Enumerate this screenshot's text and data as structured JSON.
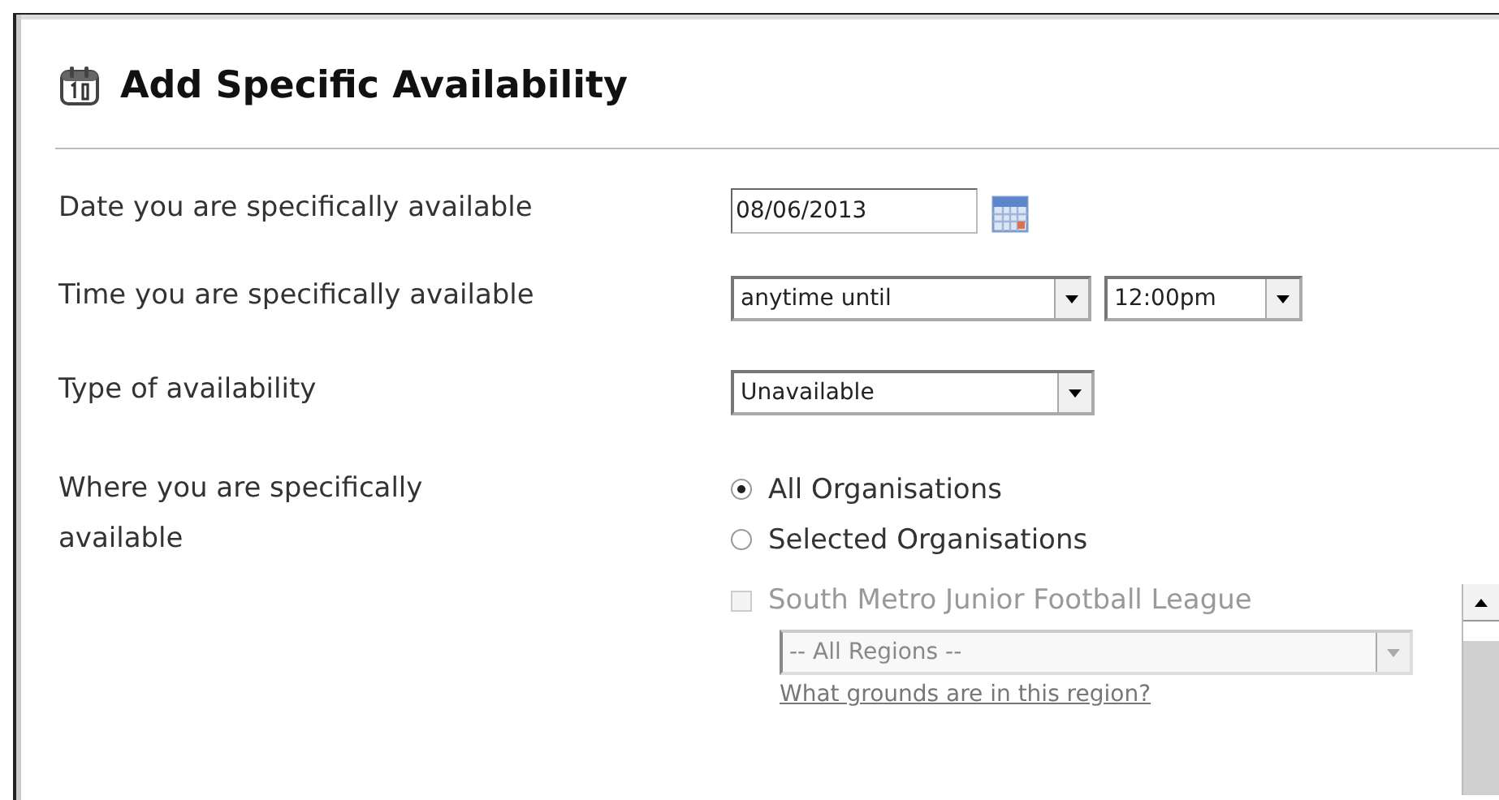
{
  "title": "Add Specific Availability",
  "fields": [
    {
      "kind": "date",
      "label": "Date you are specifically available",
      "value": "08/06/2013"
    },
    {
      "kind": "selects",
      "label": "Time you are specifically available",
      "selects": [
        "anytime until",
        "12:00pm"
      ]
    },
    {
      "kind": "selects",
      "label": "Type of availability",
      "selects": [
        "Unavailable"
      ]
    },
    {
      "kind": "radios",
      "label": "Where you are specifically available",
      "options": [
        {
          "label": "All Organisations",
          "selected": true
        },
        {
          "label": "Selected Organisations",
          "selected": false
        }
      ],
      "organisations": [
        {
          "name": "South Metro Junior Football League",
          "checked": false,
          "disabled": true,
          "region": "-- All Regions --",
          "link": "What grounds are in this region?"
        }
      ]
    }
  ]
}
